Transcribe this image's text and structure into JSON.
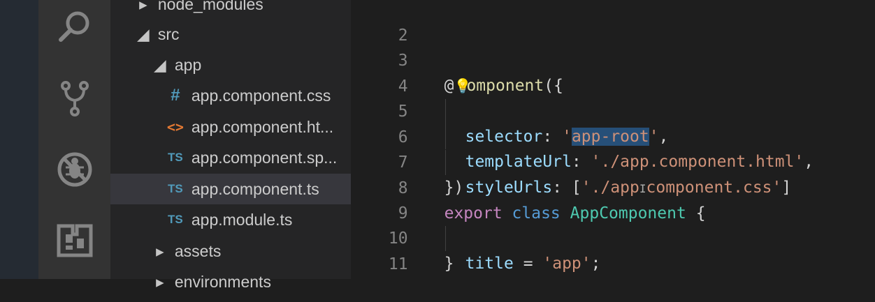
{
  "explorer": {
    "items": [
      {
        "label": "node_modules",
        "kind": "folder",
        "expanded": false
      },
      {
        "label": "src",
        "kind": "folder",
        "expanded": true
      },
      {
        "label": "app",
        "kind": "folder",
        "expanded": true
      },
      {
        "label": "app.component.css",
        "kind": "css",
        "icon": "#"
      },
      {
        "label": "app.component.ht...",
        "kind": "html",
        "icon": "<>"
      },
      {
        "label": "app.component.sp...",
        "kind": "ts",
        "icon": "TS"
      },
      {
        "label": "app.component.ts",
        "kind": "ts",
        "icon": "TS",
        "selected": true
      },
      {
        "label": "app.module.ts",
        "kind": "ts",
        "icon": "TS"
      },
      {
        "label": "assets",
        "kind": "folder",
        "expanded": false
      },
      {
        "label": "environments",
        "kind": "folder",
        "expanded": false
      }
    ]
  },
  "activity_icons": [
    "search-icon",
    "source-control-icon",
    "debug-icon",
    "extensions-icon"
  ],
  "editor": {
    "lines": [
      {
        "n": "2"
      },
      {
        "n": "3"
      },
      {
        "n": "4"
      },
      {
        "n": "5"
      },
      {
        "n": "6"
      },
      {
        "n": "7"
      },
      {
        "n": "8"
      },
      {
        "n": "9"
      },
      {
        "n": "10"
      },
      {
        "n": "11"
      }
    ],
    "tokens": {
      "at": "@",
      "component_rest": "omponent",
      "open": "({",
      "selector_key": "selector",
      "colon_space": ": ",
      "selector_value": "app-root",
      "quote": "'",
      "comma": ",",
      "templateUrl_key": "templateUrl",
      "templateUrl_value": "'./app.component.html'",
      "styleUrls_key": "styleUrls",
      "bracket_open": "[",
      "styleUrls_value_a": "'./app",
      "styleUrls_value_b": "component.css'",
      "bracket_close": "]",
      "close": "})",
      "export_kw": "export",
      "class_kw": "class",
      "class_name": "AppComponent",
      "brace_open": "{",
      "title_key": "title",
      "equals": " = ",
      "title_value": "'app'",
      "semicolon": ";",
      "brace_close": "}"
    }
  },
  "colors": {
    "keyword": "#c586c0",
    "storage": "#569cd6",
    "class_name": "#4ec9b0",
    "property": "#9cdcfe",
    "string": "#ce9178",
    "selection": "#264f78"
  }
}
